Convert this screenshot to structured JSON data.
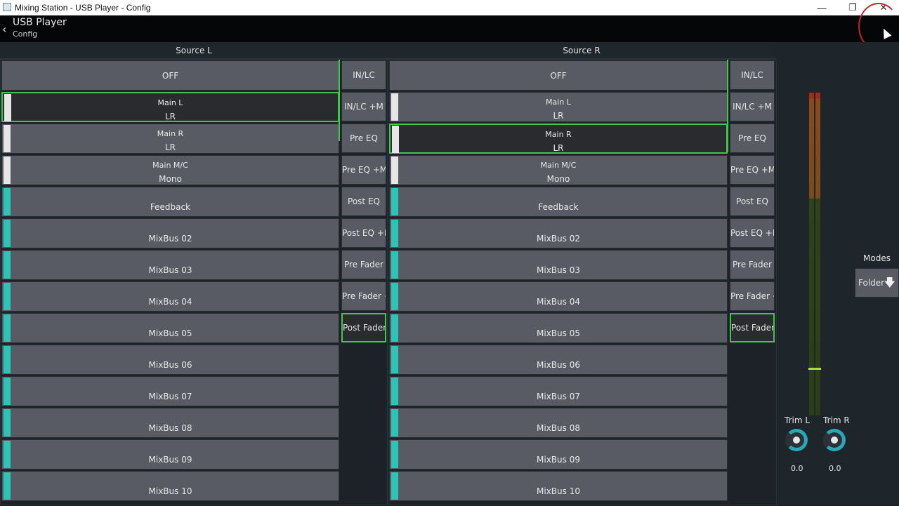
{
  "window": {
    "title": "Mixing Station - USB Player - Config",
    "minimize": "—",
    "restore": "❐",
    "close": "✕"
  },
  "header": {
    "back": "‹",
    "title": "USB Player",
    "subtitle": "Config"
  },
  "colors": {
    "selected_border": "#3fc94a",
    "white_strip": "#e6e6e6",
    "cyan_strip": "#2bc4b6",
    "button_bg": "#585b63"
  },
  "source_l": {
    "heading": "Source L",
    "sources": [
      {
        "l1": "",
        "l2": "OFF",
        "strip": "none",
        "selected": false
      },
      {
        "l1": "Main L",
        "l2": "LR",
        "strip": "white",
        "selected": true
      },
      {
        "l1": "Main R",
        "l2": "LR",
        "strip": "white",
        "selected": false
      },
      {
        "l1": "Main M/C",
        "l2": "Mono",
        "strip": "white",
        "selected": false
      },
      {
        "l1": "",
        "l2": "Feedback",
        "strip": "cyan",
        "selected": false
      },
      {
        "l1": "",
        "l2": "MixBus 02",
        "strip": "cyan",
        "selected": false
      },
      {
        "l1": "",
        "l2": "MixBus 03",
        "strip": "cyan",
        "selected": false
      },
      {
        "l1": "",
        "l2": "MixBus 04",
        "strip": "cyan",
        "selected": false
      },
      {
        "l1": "",
        "l2": "MixBus 05",
        "strip": "cyan",
        "selected": false
      },
      {
        "l1": "",
        "l2": "MixBus 06",
        "strip": "cyan",
        "selected": false
      },
      {
        "l1": "",
        "l2": "MixBus 07",
        "strip": "cyan",
        "selected": false
      },
      {
        "l1": "",
        "l2": "MixBus 08",
        "strip": "cyan",
        "selected": false
      },
      {
        "l1": "",
        "l2": "MixBus 09",
        "strip": "cyan",
        "selected": false
      },
      {
        "l1": "",
        "l2": "MixBus 10",
        "strip": "cyan",
        "selected": false
      }
    ],
    "taps": [
      {
        "label": "IN/LC",
        "selected": false
      },
      {
        "label": "IN/LC +M",
        "selected": false
      },
      {
        "label": "Pre EQ",
        "selected": false
      },
      {
        "label": "Pre EQ +M",
        "selected": false
      },
      {
        "label": "Post EQ",
        "selected": false
      },
      {
        "label": "Post EQ +M",
        "selected": false
      },
      {
        "label": "Pre Fader",
        "selected": false
      },
      {
        "label": "Pre Fader +M",
        "selected": false
      },
      {
        "label": "Post Fader",
        "selected": true
      }
    ]
  },
  "source_r": {
    "heading": "Source R",
    "sources": [
      {
        "l1": "",
        "l2": "OFF",
        "strip": "none",
        "selected": false
      },
      {
        "l1": "Main L",
        "l2": "LR",
        "strip": "white",
        "selected": false
      },
      {
        "l1": "Main R",
        "l2": "LR",
        "strip": "white",
        "selected": true
      },
      {
        "l1": "Main M/C",
        "l2": "Mono",
        "strip": "white",
        "selected": false
      },
      {
        "l1": "",
        "l2": "Feedback",
        "strip": "cyan",
        "selected": false
      },
      {
        "l1": "",
        "l2": "MixBus 02",
        "strip": "cyan",
        "selected": false
      },
      {
        "l1": "",
        "l2": "MixBus 03",
        "strip": "cyan",
        "selected": false
      },
      {
        "l1": "",
        "l2": "MixBus 04",
        "strip": "cyan",
        "selected": false
      },
      {
        "l1": "",
        "l2": "MixBus 05",
        "strip": "cyan",
        "selected": false
      },
      {
        "l1": "",
        "l2": "MixBus 06",
        "strip": "cyan",
        "selected": false
      },
      {
        "l1": "",
        "l2": "MixBus 07",
        "strip": "cyan",
        "selected": false
      },
      {
        "l1": "",
        "l2": "MixBus 08",
        "strip": "cyan",
        "selected": false
      },
      {
        "l1": "",
        "l2": "MixBus 09",
        "strip": "cyan",
        "selected": false
      },
      {
        "l1": "",
        "l2": "MixBus 10",
        "strip": "cyan",
        "selected": false
      }
    ],
    "taps": [
      {
        "label": "IN/LC",
        "selected": false
      },
      {
        "label": "IN/LC +M",
        "selected": false
      },
      {
        "label": "Pre EQ",
        "selected": false
      },
      {
        "label": "Pre EQ +M",
        "selected": false
      },
      {
        "label": "Post EQ",
        "selected": false
      },
      {
        "label": "Post EQ +M",
        "selected": false
      },
      {
        "label": "Pre Fader",
        "selected": false
      },
      {
        "label": "Pre Fader +M",
        "selected": false
      },
      {
        "label": "Post Fader",
        "selected": true
      }
    ]
  },
  "trim": {
    "left": {
      "label": "Trim L",
      "value": "0.0"
    },
    "right": {
      "label": "Trim R",
      "value": "0.0"
    }
  },
  "modes": {
    "label": "Modes",
    "button": "Folder",
    "button_icon": "arrow-down-icon"
  }
}
